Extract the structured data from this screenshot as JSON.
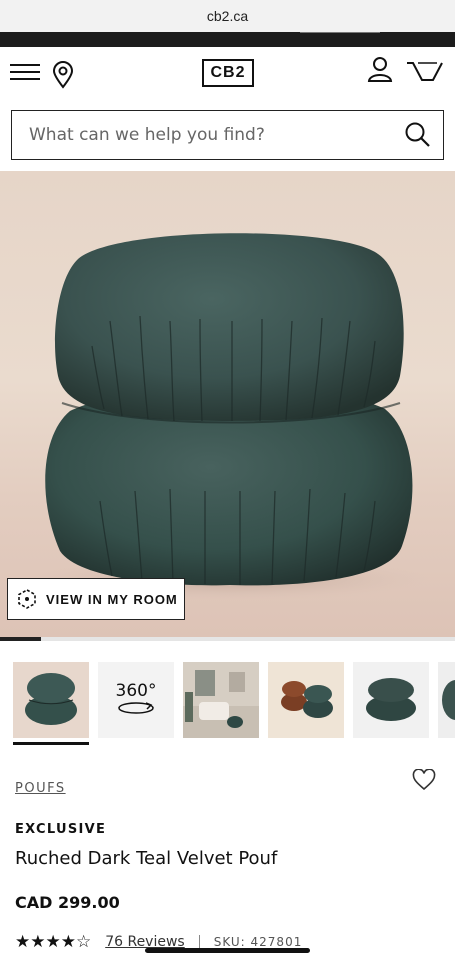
{
  "browser": {
    "url": "cb2.ca"
  },
  "header": {
    "logo": "CB2"
  },
  "search": {
    "placeholder": "What can we help you find?"
  },
  "hero": {
    "view_in_room_label": "VIEW IN MY ROOM",
    "gallery_progress": 0.09
  },
  "thumbnails": [
    {
      "name": "pouf-front"
    },
    {
      "name": "360-view",
      "label": "360°"
    },
    {
      "name": "living-room"
    },
    {
      "name": "pouf-pair"
    },
    {
      "name": "pouf-side"
    }
  ],
  "product": {
    "category": "POUFS",
    "badge": "EXCLUSIVE",
    "title": "Ruched Dark Teal Velvet Pouf",
    "price": "CAD 299.00",
    "rating": 4,
    "rating_max": 5,
    "stars_text": "★★★★☆",
    "reviews": "76 Reviews",
    "sku": "SKU: 427801"
  },
  "colors": {
    "velvet_teal": "#3b5451",
    "background": "#e6d5c8"
  }
}
